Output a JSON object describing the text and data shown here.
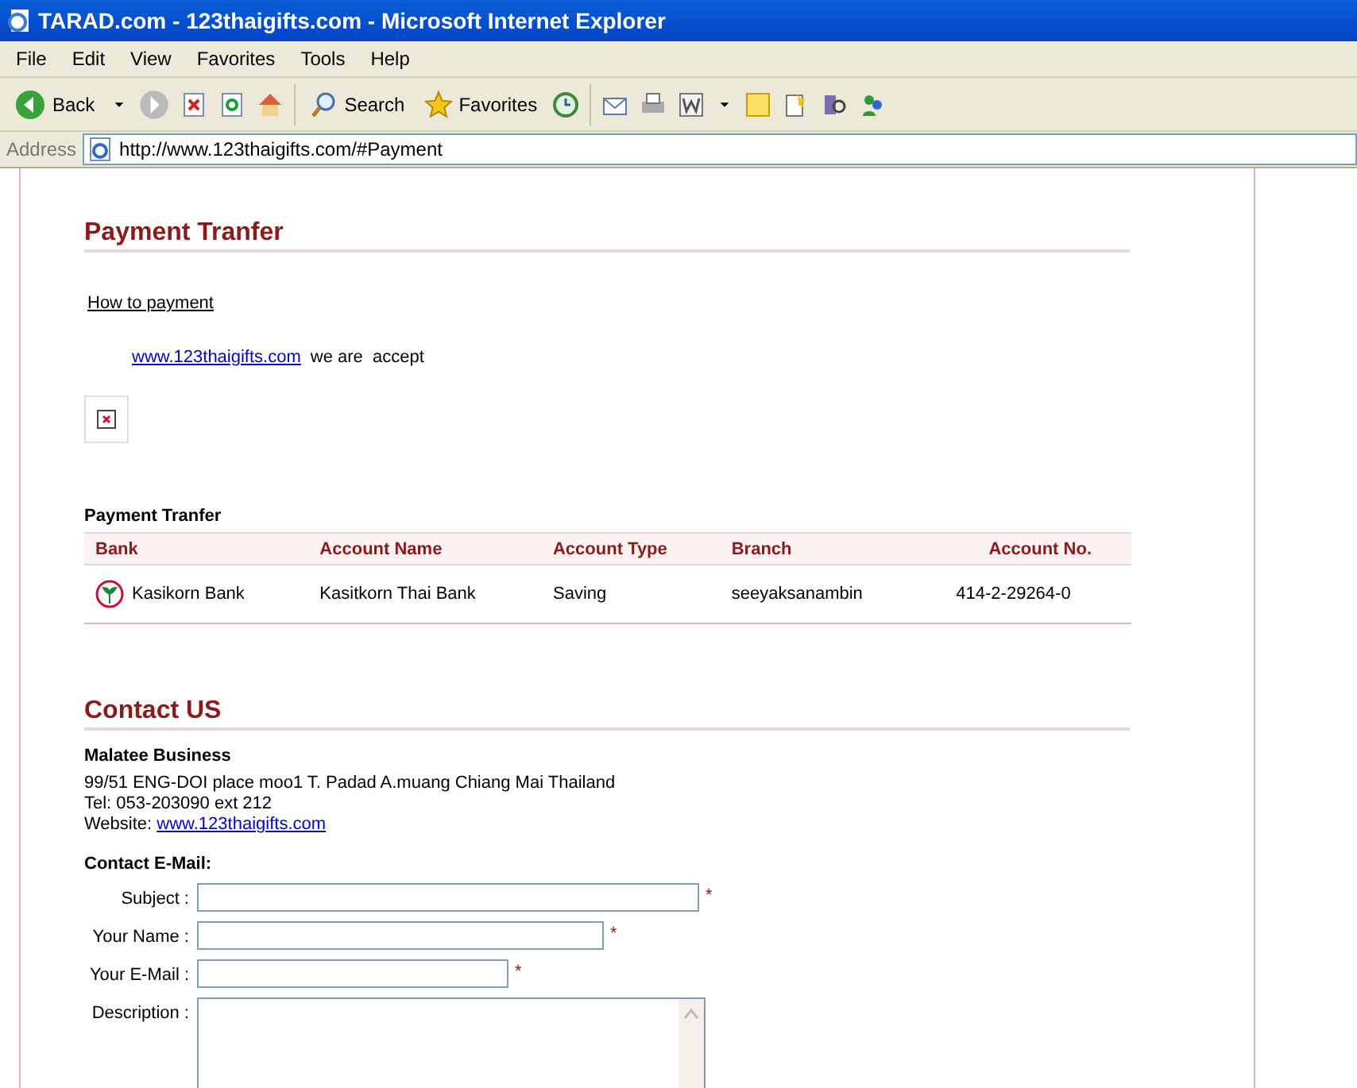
{
  "window": {
    "title": "TARAD.com - 123thaigifts.com - Microsoft Internet Explorer"
  },
  "menu": [
    "File",
    "Edit",
    "View",
    "Favorites",
    "Tools",
    "Help"
  ],
  "toolbar": {
    "back": "Back",
    "search": "Search",
    "favorites": "Favorites"
  },
  "address": {
    "label": "Address",
    "url": "http://www.123thaigifts.com/#Payment"
  },
  "payment": {
    "heading": "Payment Tranfer",
    "how_to": "How to payment",
    "site_link": "www.123thaigifts.com",
    "accept_text": "we are  accept",
    "table_title": "Payment Tranfer",
    "columns": [
      "Bank",
      "Account Name",
      "Account Type",
      "Branch",
      "Account No."
    ],
    "rows": [
      {
        "bank": "Kasikorn Bank",
        "account_name": "Kasitkorn Thai Bank",
        "account_type": "Saving",
        "branch": "seeyaksanambin",
        "account_no": "414-2-29264-0"
      }
    ]
  },
  "contact": {
    "heading": "Contact US",
    "company": "Malatee Business",
    "address": "99/51 ENG-DOI place moo1 T. Padad A.muang Chiang Mai Thailand",
    "tel": "Tel: 053-203090 ext 212",
    "website_label": "Website:",
    "website_link": "www.123thaigifts.com",
    "form_title": "Contact E-Mail:",
    "fields": [
      {
        "label": "Subject :",
        "kind": "long",
        "required_mark": "*"
      },
      {
        "label": "Your Name :",
        "kind": "medium",
        "required_mark": "*"
      },
      {
        "label": "Your E-Mail :",
        "kind": "short",
        "required_mark": "*"
      },
      {
        "label": "Description :",
        "kind": "textarea"
      }
    ]
  }
}
